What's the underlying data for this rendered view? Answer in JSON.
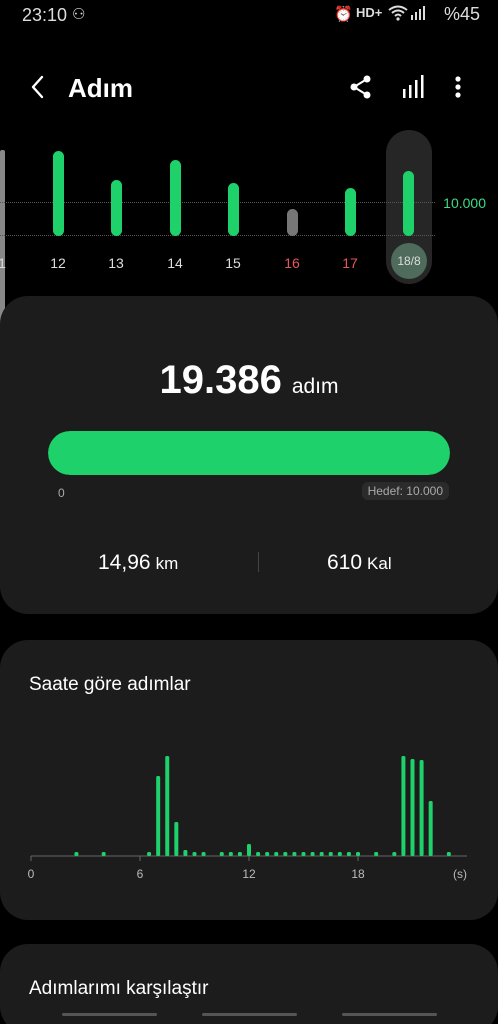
{
  "status_bar": {
    "time": "23:10",
    "indicators": "HD+",
    "battery": "%45"
  },
  "header": {
    "title": "Adım",
    "icons": [
      "back-icon",
      "share-icon",
      "bar-chart-icon",
      "more-icon"
    ]
  },
  "daily_chart": {
    "goal_label": "10.000",
    "days": [
      {
        "label": "12",
        "steps_fraction": 0.85,
        "color": "green"
      },
      {
        "label": "13",
        "steps_fraction": 0.56,
        "color": "green"
      },
      {
        "label": "14",
        "steps_fraction": 0.76,
        "color": "green"
      },
      {
        "label": "15",
        "steps_fraction": 0.53,
        "color": "green"
      },
      {
        "label": "16",
        "steps_fraction": 0.27,
        "color": "grey",
        "weekend": true
      },
      {
        "label": "17",
        "steps_fraction": 0.48,
        "color": "green",
        "weekend": true
      }
    ],
    "selected": {
      "label": "18/8",
      "steps_fraction": 0.65
    },
    "partial_left_label": "1"
  },
  "summary": {
    "steps": "19.386",
    "unit": "adım",
    "progress_fraction": 1.0,
    "start_label": "0",
    "goal_label": "Hedef: 10.000",
    "distance_value": "14,96",
    "distance_unit": "km",
    "calories_value": "610",
    "calories_unit": "Kal"
  },
  "hourly": {
    "title": "Saate göre adımlar",
    "chart_data": {
      "type": "bar",
      "xlabel_unit": "(s)",
      "x_ticks": [
        "0",
        "6",
        "12",
        "18"
      ],
      "x_range": [
        0,
        24
      ],
      "values": [
        {
          "hour": 2.5,
          "v": 0.04
        },
        {
          "hour": 4.0,
          "v": 0.04
        },
        {
          "hour": 6.5,
          "v": 0.04
        },
        {
          "hour": 7.0,
          "v": 0.8
        },
        {
          "hour": 7.5,
          "v": 1.0
        },
        {
          "hour": 8.0,
          "v": 0.34
        },
        {
          "hour": 8.5,
          "v": 0.06
        },
        {
          "hour": 9.0,
          "v": 0.04
        },
        {
          "hour": 9.5,
          "v": 0.04
        },
        {
          "hour": 10.5,
          "v": 0.04
        },
        {
          "hour": 11.0,
          "v": 0.04
        },
        {
          "hour": 11.5,
          "v": 0.04
        },
        {
          "hour": 12.0,
          "v": 0.12
        },
        {
          "hour": 12.5,
          "v": 0.04
        },
        {
          "hour": 13.0,
          "v": 0.04
        },
        {
          "hour": 13.5,
          "v": 0.04
        },
        {
          "hour": 14.0,
          "v": 0.04
        },
        {
          "hour": 14.5,
          "v": 0.04
        },
        {
          "hour": 15.0,
          "v": 0.04
        },
        {
          "hour": 15.5,
          "v": 0.04
        },
        {
          "hour": 16.0,
          "v": 0.04
        },
        {
          "hour": 16.5,
          "v": 0.04
        },
        {
          "hour": 17.0,
          "v": 0.04
        },
        {
          "hour": 17.5,
          "v": 0.04
        },
        {
          "hour": 18.0,
          "v": 0.04
        },
        {
          "hour": 19.0,
          "v": 0.04
        },
        {
          "hour": 20.0,
          "v": 0.04
        },
        {
          "hour": 20.5,
          "v": 1.0
        },
        {
          "hour": 21.0,
          "v": 0.97
        },
        {
          "hour": 21.5,
          "v": 0.96
        },
        {
          "hour": 22.0,
          "v": 0.55
        },
        {
          "hour": 23.0,
          "v": 0.04
        }
      ]
    }
  },
  "compare": {
    "title": "Adımlarımı karşılaştır"
  },
  "colors": {
    "accent": "#1ed16b",
    "background": "#000000",
    "card": "#1c1c1c",
    "weekend": "#e5565a"
  }
}
